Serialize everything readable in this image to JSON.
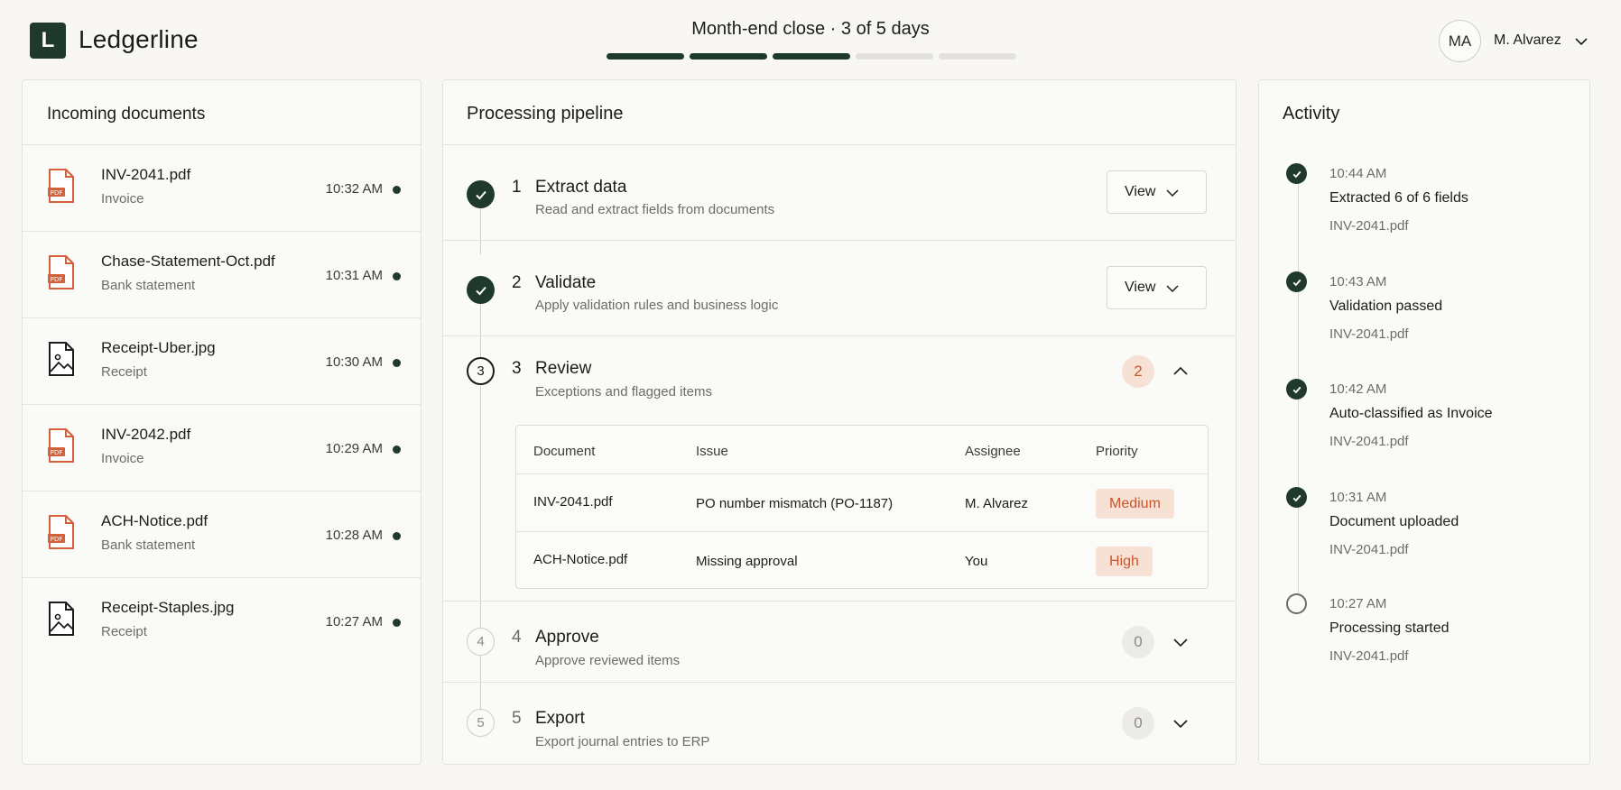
{
  "app": {
    "logo_letter": "L",
    "name": "Ledgerline"
  },
  "progress": {
    "title": "Month-end close · 3 of 5 days",
    "completed": 3,
    "total": 5
  },
  "user": {
    "initials": "MA",
    "name": "M. Alvarez"
  },
  "documents": {
    "title": "Incoming documents",
    "items": [
      {
        "name": "INV-2041.pdf",
        "type": "Invoice",
        "time": "10:32 AM",
        "icon": "pdf-file-icon"
      },
      {
        "name": "Chase-Statement-Oct.pdf",
        "type": "Bank statement",
        "time": "10:31 AM",
        "icon": "pdf-file-icon"
      },
      {
        "name": "Receipt-Uber.jpg",
        "type": "Receipt",
        "time": "10:30 AM",
        "icon": "image-file-icon"
      },
      {
        "name": "INV-2042.pdf",
        "type": "Invoice",
        "time": "10:29 AM",
        "icon": "pdf-file-icon"
      },
      {
        "name": "ACH-Notice.pdf",
        "type": "Bank statement",
        "time": "10:28 AM",
        "icon": "pdf-file-icon"
      },
      {
        "name": "Receipt-Staples.jpg",
        "type": "Receipt",
        "time": "10:27 AM",
        "icon": "image-file-icon"
      }
    ]
  },
  "pipeline": {
    "title": "Processing pipeline",
    "steps": [
      {
        "num": "1",
        "title": "Extract data",
        "desc": "Read and extract fields from documents",
        "status": "done",
        "action": "View"
      },
      {
        "num": "2",
        "title": "Validate",
        "desc": "Apply validation rules and business logic",
        "status": "done",
        "action": "View"
      },
      {
        "num": "3",
        "title": "Review",
        "desc": "Exceptions and flagged items",
        "status": "current",
        "count": "2"
      },
      {
        "num": "4",
        "title": "Approve",
        "desc": "Approve reviewed items",
        "status": "pending",
        "count": "0"
      },
      {
        "num": "5",
        "title": "Export",
        "desc": "Export journal entries to ERP",
        "status": "pending",
        "count": "0"
      }
    ],
    "review_table": {
      "headers": [
        "Document",
        "Issue",
        "Assignee",
        "Priority"
      ],
      "rows": [
        {
          "document": "INV-2041.pdf",
          "issue": "PO number mismatch (PO-1187)",
          "assignee": "M. Alvarez",
          "priority": "Medium"
        },
        {
          "document": "ACH-Notice.pdf",
          "issue": "Missing approval",
          "assignee": "You",
          "priority": "High"
        }
      ]
    }
  },
  "activity": {
    "title": "Activity",
    "items": [
      {
        "time": "10:44 AM",
        "text": "Extracted 6 of 6 fields",
        "file": "INV-2041.pdf",
        "status": "done"
      },
      {
        "time": "10:43 AM",
        "text": "Validation passed",
        "file": "INV-2041.pdf",
        "status": "done"
      },
      {
        "time": "10:42 AM",
        "text": "Auto-classified as Invoice",
        "file": "INV-2041.pdf",
        "status": "done"
      },
      {
        "time": "10:31 AM",
        "text": "Document uploaded",
        "file": "INV-2041.pdf",
        "status": "done"
      },
      {
        "time": "10:27 AM",
        "text": "Processing started",
        "file": "INV-2041.pdf",
        "status": "pending"
      }
    ]
  },
  "colors": {
    "brand": "#1f3a2c",
    "alert": "#c7572d",
    "alert_bg": "#f7e1d5"
  }
}
